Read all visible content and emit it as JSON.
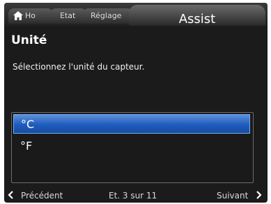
{
  "tabs": {
    "home_label": "Ho",
    "etat_label": "Etat",
    "reglage_label": "Réglage",
    "active_label": "Assist"
  },
  "page": {
    "title": "Unité",
    "instruction": "Sélectionnez l'unité du capteur."
  },
  "options": [
    {
      "label": "°C",
      "selected": true
    },
    {
      "label": "°F",
      "selected": false
    }
  ],
  "footer": {
    "prev_label": "Précédent",
    "step_text": "Et. 3 sur 11",
    "next_label": "Suivant"
  },
  "colors": {
    "selection": "#1e5cbd",
    "background": "#1b1b1b"
  },
  "icons": {
    "home": "home-icon",
    "prev": "chevron-left-icon",
    "next": "chevron-right-icon"
  }
}
